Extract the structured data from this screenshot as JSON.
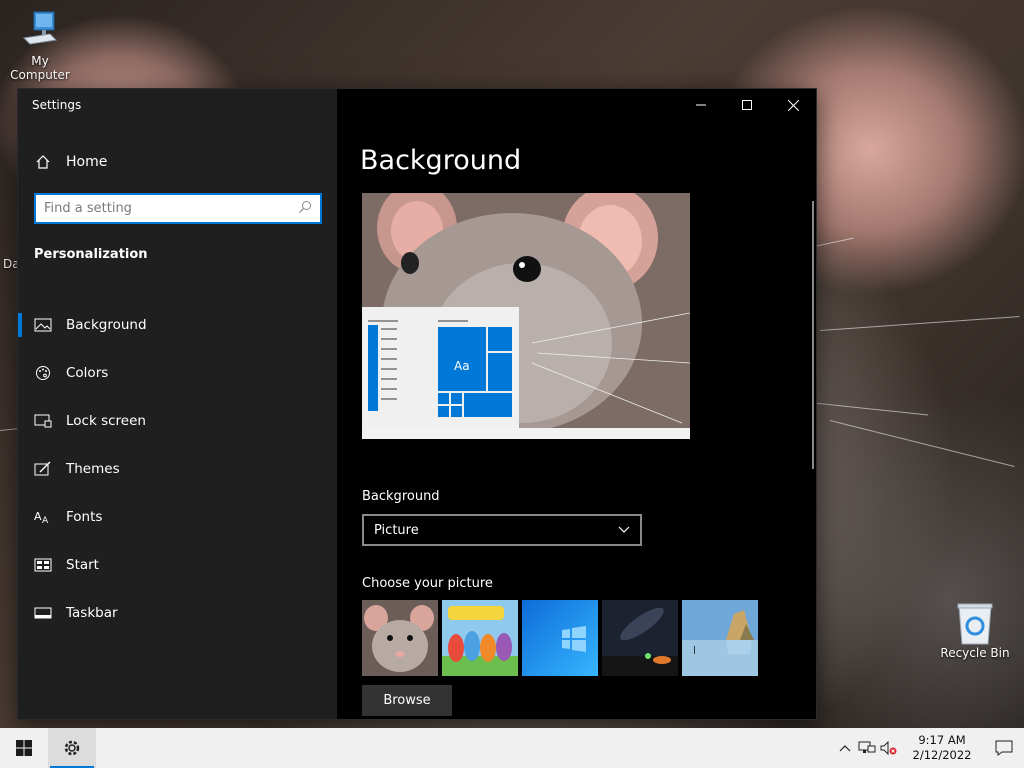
{
  "desktop": {
    "icons": [
      {
        "label": "My Computer"
      },
      {
        "label": "Recycle Bin"
      }
    ],
    "partial_labels": [
      "Da"
    ]
  },
  "window": {
    "title": "Settings",
    "sidebar": {
      "home_label": "Home",
      "search_placeholder": "Find a setting",
      "section_title": "Personalization",
      "items": [
        {
          "label": "Background",
          "icon": "background-icon",
          "active": true
        },
        {
          "label": "Colors",
          "icon": "palette-icon"
        },
        {
          "label": "Lock screen",
          "icon": "lock-screen-icon"
        },
        {
          "label": "Themes",
          "icon": "themes-icon"
        },
        {
          "label": "Fonts",
          "icon": "fonts-icon"
        },
        {
          "label": "Start",
          "icon": "start-icon"
        },
        {
          "label": "Taskbar",
          "icon": "taskbar-icon"
        }
      ]
    },
    "content": {
      "page_title": "Background",
      "preview_tile_text": "Aa",
      "background_label": "Background",
      "background_select_value": "Picture",
      "choose_label": "Choose your picture",
      "browse_label": "Browse"
    }
  },
  "taskbar": {
    "time": "9:17 AM",
    "date": "2/12/2022"
  },
  "colors": {
    "accent": "#0078d7",
    "sidebar_bg": "#1f1f1f",
    "content_bg": "#000000",
    "taskbar_bg": "#f0f0f0"
  }
}
